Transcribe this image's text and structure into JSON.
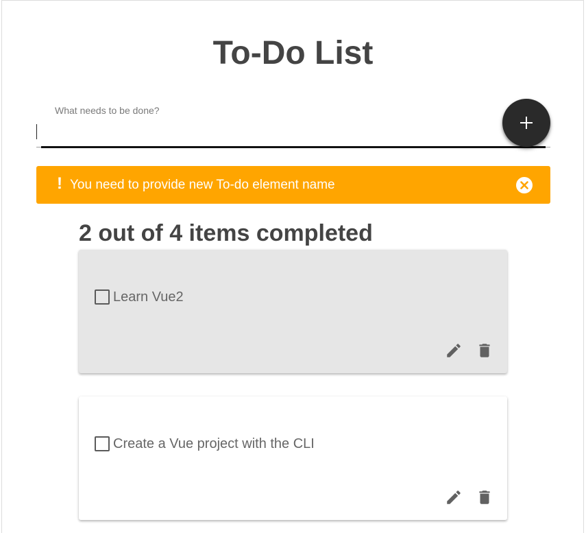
{
  "page": {
    "title": "To-Do List"
  },
  "new_item": {
    "label": "What needs to be done?",
    "value": "",
    "add_icon": "plus-icon"
  },
  "alert": {
    "icon": "exclamation-icon",
    "message": "You need to provide new To-do element name",
    "close_icon": "close-circle-icon",
    "color": "#ffa500"
  },
  "summary": {
    "text": "2 out of 4 items completed",
    "completed": 2,
    "total": 4
  },
  "todos": [
    {
      "text": "Learn Vue2",
      "checked": false,
      "background": "#e6e6e6",
      "edit_icon": "pencil-icon",
      "delete_icon": "trash-icon"
    },
    {
      "text": "Create a Vue project with the CLI",
      "checked": false,
      "background": "#ffffff",
      "edit_icon": "pencil-icon",
      "delete_icon": "trash-icon"
    }
  ],
  "colors": {
    "title": "#444444",
    "fab": "#2a2a2a",
    "icon": "#616161"
  }
}
